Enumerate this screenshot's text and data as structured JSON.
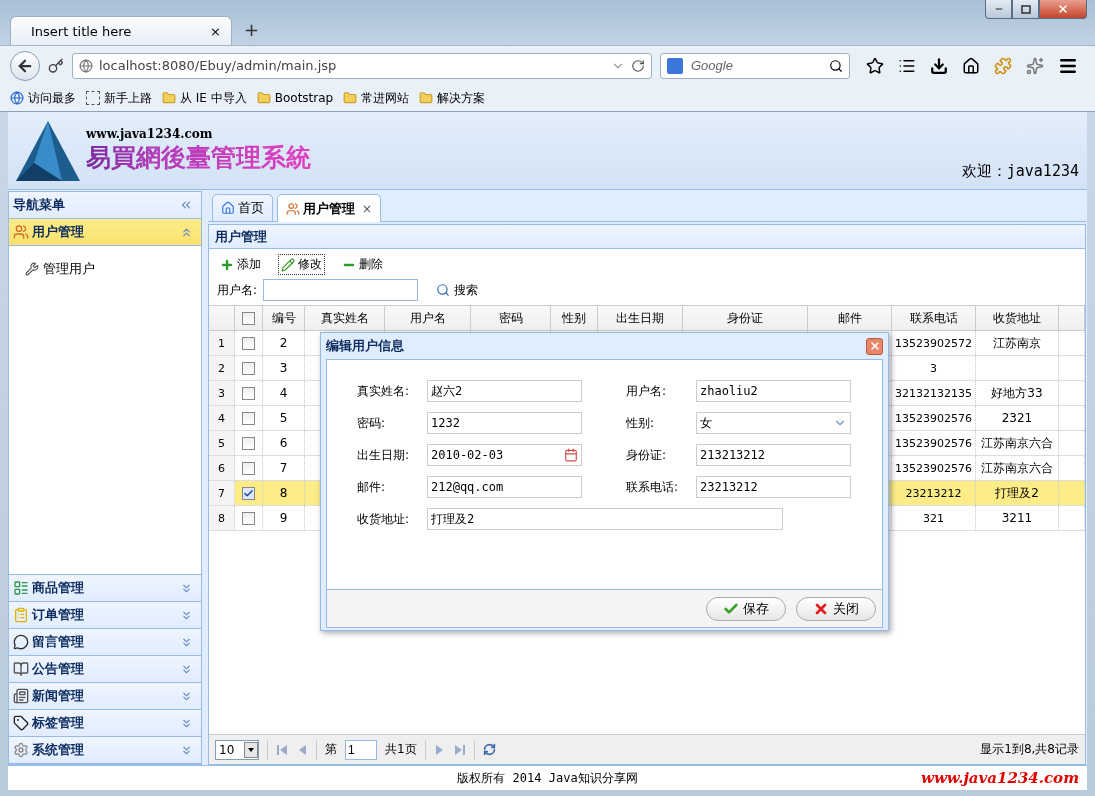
{
  "browser": {
    "tab_title": "Insert title here",
    "tab_close": "×",
    "new_tab": "+",
    "url": "localhost:8080/Ebuy/admin/main.jsp",
    "search_placeholder": "Google",
    "bookmarks": [
      "访问最多",
      "新手上路",
      "从 IE 中导入",
      "Bootstrap",
      "常进网站",
      "解决方案"
    ]
  },
  "header": {
    "site_url": "www.java1234.com",
    "system_title": "易買網後臺管理系統",
    "welcome": "欢迎：java1234"
  },
  "sidebar": {
    "title": "导航菜单",
    "panels": [
      {
        "title": "用户管理",
        "expanded": true,
        "items": [
          "管理用户"
        ]
      },
      {
        "title": "商品管理",
        "expanded": false
      },
      {
        "title": "订单管理",
        "expanded": false
      },
      {
        "title": "留言管理",
        "expanded": false
      },
      {
        "title": "公告管理",
        "expanded": false
      },
      {
        "title": "新闻管理",
        "expanded": false
      },
      {
        "title": "标签管理",
        "expanded": false
      },
      {
        "title": "系统管理",
        "expanded": false
      }
    ]
  },
  "tabs": [
    {
      "label": "首页",
      "selected": false
    },
    {
      "label": "用户管理",
      "selected": true,
      "close": "×"
    }
  ],
  "panel": {
    "title": "用户管理",
    "toolbar": [
      {
        "label": "添加",
        "kind": "add",
        "focused": false
      },
      {
        "label": "修改",
        "kind": "edit",
        "focused": true
      },
      {
        "label": "删除",
        "kind": "delete",
        "focused": false
      }
    ],
    "search": {
      "label": "用户名:",
      "button": "搜索"
    }
  },
  "grid": {
    "all_checked": false,
    "columns": [
      "编号",
      "真实姓名",
      "用户名",
      "密码",
      "性别",
      "出生日期",
      "身份证",
      "邮件",
      "联系电话",
      "收货地址"
    ],
    "rows": [
      {
        "number": "1",
        "checked": false,
        "selected": false,
        "id": "2",
        "phone": "13523902572",
        "address": "江苏南京"
      },
      {
        "number": "2",
        "checked": false,
        "selected": false,
        "id": "3",
        "phone": "3"
      },
      {
        "number": "3",
        "checked": false,
        "selected": false,
        "id": "4",
        "phone": "32132132135",
        "address": "好地方33"
      },
      {
        "number": "4",
        "checked": false,
        "selected": false,
        "id": "5",
        "phone": "13523902576",
        "address": "2321"
      },
      {
        "number": "5",
        "checked": false,
        "selected": false,
        "id": "6",
        "phone": "13523902576",
        "address": "江苏南京六合"
      },
      {
        "number": "6",
        "checked": false,
        "selected": false,
        "id": "7",
        "phone": "13523902576",
        "address": "江苏南京六合"
      },
      {
        "number": "7",
        "checked": true,
        "selected": true,
        "id": "8",
        "phone": "23213212",
        "address": "打理及2"
      },
      {
        "number": "8",
        "checked": false,
        "selected": false,
        "id": "9",
        "phone": "321",
        "address": "3211"
      }
    ]
  },
  "pager": {
    "page_size": "10",
    "page_label": "第",
    "page": "1",
    "total_pages": "共1页",
    "summary": "显示1到8,共8记录"
  },
  "dialog": {
    "title": "编辑用户信息",
    "fields": [
      {
        "label": "真实姓名:",
        "value": "赵六2",
        "kind": "text"
      },
      {
        "label": "用户名:",
        "value": "zhaoliu2",
        "kind": "text"
      },
      {
        "label": "密码:",
        "value": "1232",
        "kind": "text"
      },
      {
        "label": "性别:",
        "value": "女",
        "kind": "select"
      },
      {
        "label": "出生日期:",
        "value": "2010-02-03",
        "kind": "date"
      },
      {
        "label": "身份证:",
        "value": "213213212",
        "kind": "text"
      },
      {
        "label": "邮件:",
        "value": "212@qq.com",
        "kind": "text"
      },
      {
        "label": "联系电话:",
        "value": "23213212",
        "kind": "text"
      },
      {
        "label": "收货地址:",
        "value": "打理及2",
        "kind": "wide"
      }
    ],
    "buttons": [
      {
        "label": "保存",
        "kind": "save"
      },
      {
        "label": "关闭",
        "kind": "close"
      }
    ]
  },
  "footer": {
    "copyright": "版权所有 2014 Java知识分享网",
    "site": "www.java1234.com"
  }
}
